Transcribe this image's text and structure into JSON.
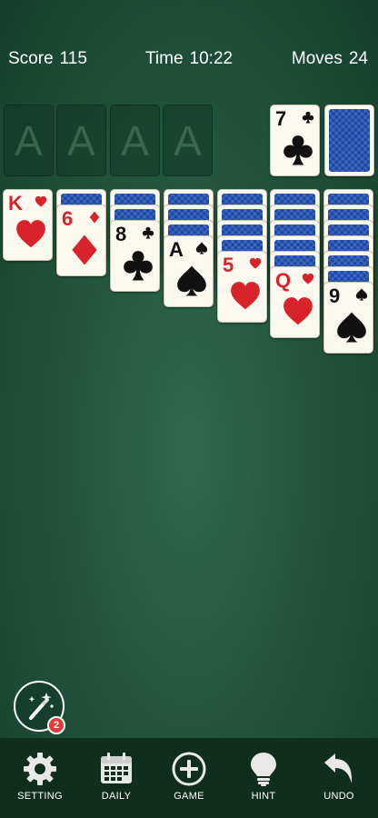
{
  "status": {
    "score_label": "Score",
    "score_value": "115",
    "time_label": "Time",
    "time_value": "10:22",
    "moves_label": "Moves",
    "moves_value": "24"
  },
  "foundations": [
    "A",
    "A",
    "A",
    "A"
  ],
  "waste": {
    "rank": "7",
    "suit": "club",
    "color": "black"
  },
  "stock": {
    "has_cards": true
  },
  "tableau": [
    {
      "face_down": 0,
      "face_up": [
        {
          "rank": "K",
          "suit": "heart",
          "color": "red"
        }
      ]
    },
    {
      "face_down": 1,
      "face_up": [
        {
          "rank": "6",
          "suit": "diamond",
          "color": "red"
        }
      ]
    },
    {
      "face_down": 2,
      "face_up": [
        {
          "rank": "8",
          "suit": "club",
          "color": "black"
        }
      ]
    },
    {
      "face_down": 3,
      "face_up": [
        {
          "rank": "A",
          "suit": "spade",
          "color": "black"
        }
      ]
    },
    {
      "face_down": 4,
      "face_up": [
        {
          "rank": "5",
          "suit": "heart",
          "color": "red"
        }
      ]
    },
    {
      "face_down": 5,
      "face_up": [
        {
          "rank": "Q",
          "suit": "heart",
          "color": "red"
        }
      ]
    },
    {
      "face_down": 6,
      "face_up": [
        {
          "rank": "9",
          "suit": "spade",
          "color": "black"
        }
      ]
    }
  ],
  "magic_wand": {
    "icon": "magic-wand-icon",
    "badge_count": "2"
  },
  "bottom_nav": [
    {
      "label": "SETTING",
      "icon": "gear-icon"
    },
    {
      "label": "DAILY",
      "icon": "calendar-icon"
    },
    {
      "label": "GAME",
      "icon": "plus-circle-icon"
    },
    {
      "label": "HINT",
      "icon": "lightbulb-icon"
    },
    {
      "label": "UNDO",
      "icon": "undo-icon"
    }
  ],
  "colors": {
    "felt": "#23553e",
    "card_back": "#1b48a8",
    "red_suit": "#d8232a",
    "nav_bg": "#0f2e1e"
  }
}
